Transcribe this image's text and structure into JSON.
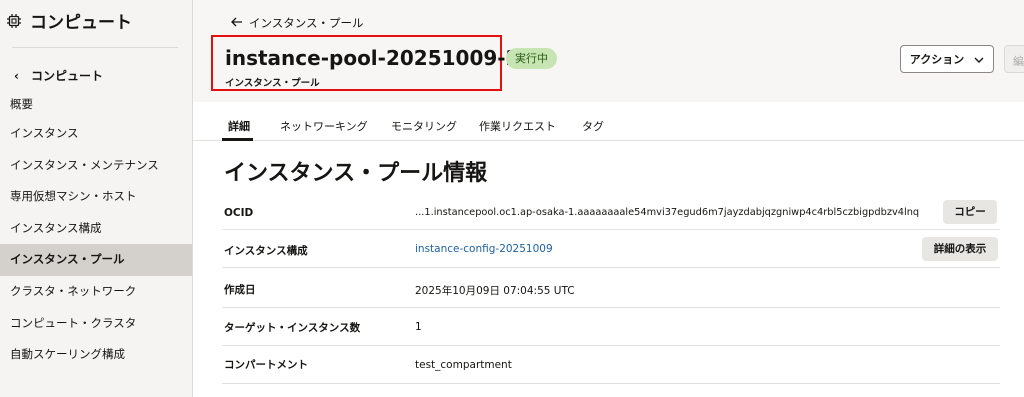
{
  "sidebar": {
    "title": "コンピュート",
    "back_label": "コンピュート",
    "items": [
      {
        "label": "概要"
      },
      {
        "label": "インスタンス"
      },
      {
        "label": "インスタンス・メンテナンス"
      },
      {
        "label": "専用仮想マシン・ホスト"
      },
      {
        "label": "インスタンス構成"
      },
      {
        "label": "インスタンス・プール"
      },
      {
        "label": "クラスタ・ネットワーク"
      },
      {
        "label": "コンピュート・クラスタ"
      },
      {
        "label": "自動スケーリング構成"
      }
    ],
    "active_index": 5
  },
  "header": {
    "breadcrumb": "インスタンス・プール",
    "title": "instance-pool-20251009-2",
    "subtitle": "インスタンス・プール",
    "status": "実行中",
    "actions_label": "アクション"
  },
  "tabs": [
    {
      "label": "詳細",
      "active": true
    },
    {
      "label": "ネットワーキング",
      "active": false
    },
    {
      "label": "モニタリング",
      "active": false
    },
    {
      "label": "作業リクエスト",
      "active": false
    },
    {
      "label": "タグ",
      "active": false
    }
  ],
  "details": {
    "section_title": "インスタンス・プール情報",
    "rows": [
      {
        "label": "OCID",
        "value": "...1.instancepool.oc1.ap-osaka-1.aaaaaaaale54mvi37egud6m7jayzdabjqzgniwp4c4rbl5czbigpdbzv4lnq",
        "button": "コピー"
      },
      {
        "label": "インスタンス構成",
        "value": "instance-config-20251009",
        "button": "詳細の表示"
      },
      {
        "label": "作成日",
        "value": "2025年10月09日 07:04:55 UTC"
      },
      {
        "label": "ターゲット・インスタンス数",
        "value": "1"
      },
      {
        "label": "コンパートメント",
        "value": "test_compartment"
      }
    ]
  },
  "colors": {
    "highlight_box": "#e41010",
    "status_bg": "#c6e5b3",
    "link": "#2161a0",
    "active_sidebar": "#d4d1cc"
  },
  "icons": {
    "sidebar_title": "chip-icon",
    "back": "chevron-left-icon",
    "breadcrumb": "arrow-left-icon",
    "actions": "chevron-down-icon"
  }
}
